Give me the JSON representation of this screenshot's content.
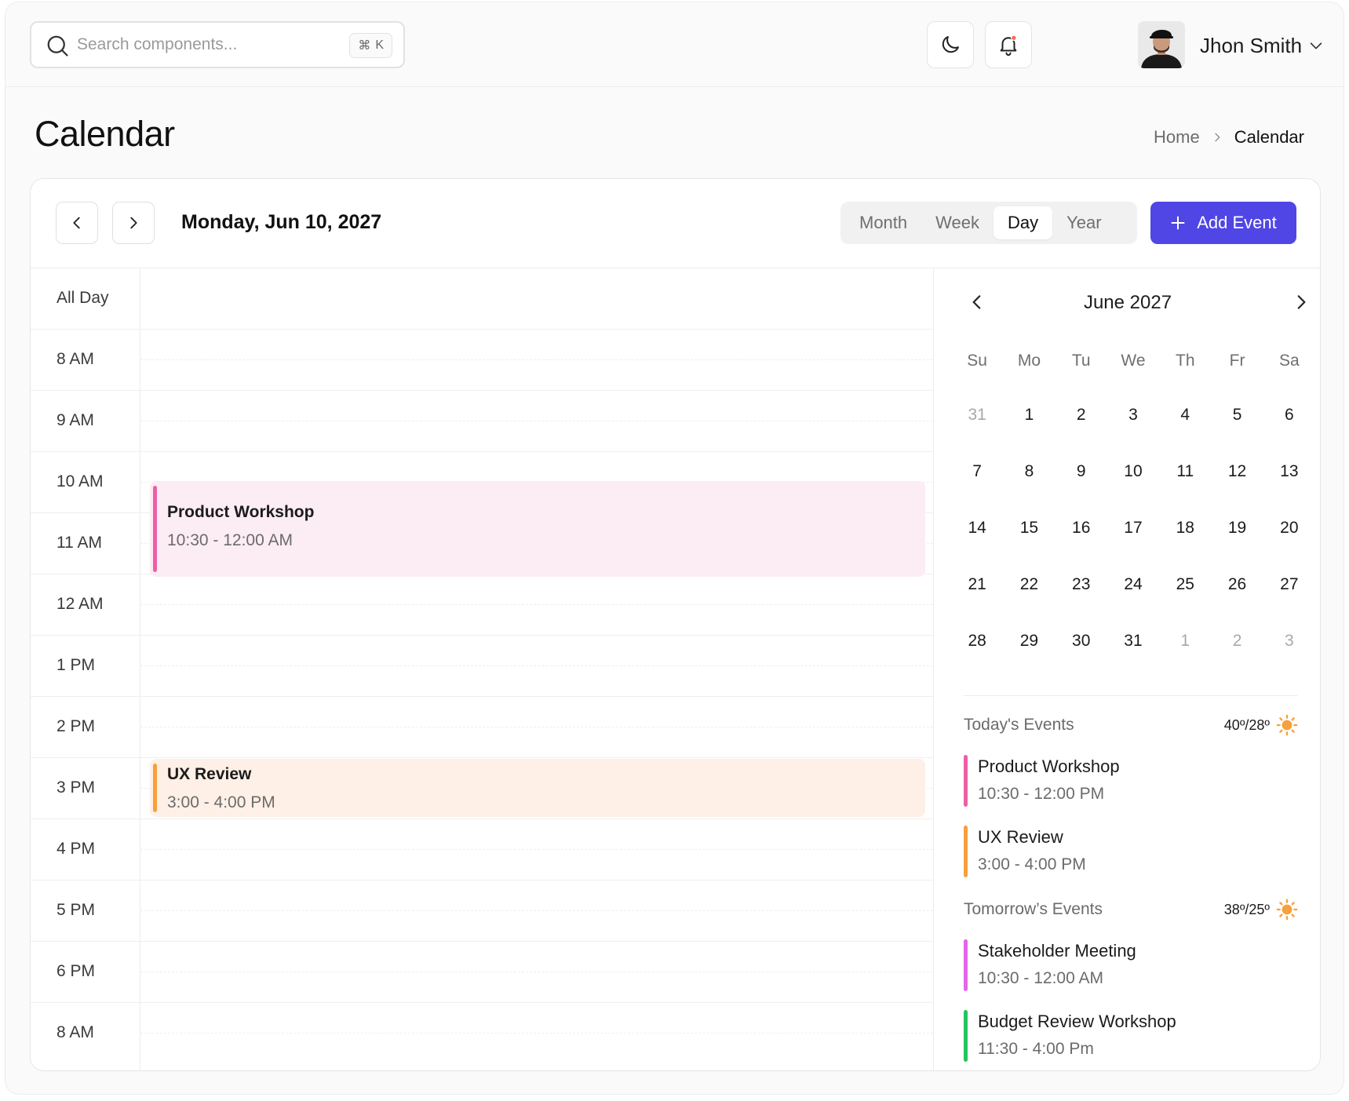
{
  "header": {
    "search_placeholder": "Search components...",
    "search_shortcut_symbol": "⌘",
    "search_shortcut_key": "K",
    "user_name": "Jhon Smith",
    "notification_dot_color": "#f26b5b"
  },
  "page": {
    "title": "Calendar",
    "breadcrumb": {
      "home": "Home",
      "current": "Calendar"
    }
  },
  "toolbar": {
    "current_date": "Monday, Jun 10, 2027",
    "views": [
      "Month",
      "Week",
      "Day",
      "Year"
    ],
    "active_view": "Day",
    "add_event_label": "Add Event",
    "accent_color": "#4f46e5"
  },
  "day_grid": {
    "all_day_label": "All Day",
    "hours": [
      "8 AM",
      "9 AM",
      "10 AM",
      "11 AM",
      "12 AM",
      "1 PM",
      "2 PM",
      "3 PM",
      "4 PM",
      "5 PM",
      "6 PM",
      "8 AM"
    ],
    "events": [
      {
        "title": "Product Workshop",
        "time": "10:30 - 12:00 AM",
        "color": "#ec5fa5"
      },
      {
        "title": "UX Review",
        "time": "3:00 - 4:00 PM",
        "color": "#f7a03c"
      }
    ]
  },
  "mini_calendar": {
    "title": "June 2027",
    "weekdays": [
      "Su",
      "Mo",
      "Tu",
      "We",
      "Th",
      "Fr",
      "Sa"
    ],
    "weeks": [
      [
        {
          "d": "31",
          "m": true
        },
        {
          "d": "1"
        },
        {
          "d": "2"
        },
        {
          "d": "3"
        },
        {
          "d": "4"
        },
        {
          "d": "5"
        },
        {
          "d": "6"
        }
      ],
      [
        {
          "d": "7"
        },
        {
          "d": "8"
        },
        {
          "d": "9"
        },
        {
          "d": "10"
        },
        {
          "d": "11"
        },
        {
          "d": "12"
        },
        {
          "d": "13"
        }
      ],
      [
        {
          "d": "14"
        },
        {
          "d": "15"
        },
        {
          "d": "16"
        },
        {
          "d": "17"
        },
        {
          "d": "18"
        },
        {
          "d": "19"
        },
        {
          "d": "20"
        }
      ],
      [
        {
          "d": "21"
        },
        {
          "d": "22"
        },
        {
          "d": "23"
        },
        {
          "d": "24"
        },
        {
          "d": "25"
        },
        {
          "d": "26"
        },
        {
          "d": "27"
        }
      ],
      [
        {
          "d": "28"
        },
        {
          "d": "29"
        },
        {
          "d": "30"
        },
        {
          "d": "31"
        },
        {
          "d": "1",
          "m": true
        },
        {
          "d": "2",
          "m": true
        },
        {
          "d": "3",
          "m": true
        }
      ]
    ]
  },
  "today": {
    "label": "Today's Events",
    "temperature": "40º/28º",
    "events": [
      {
        "title": "Product Workshop",
        "time": "10:30 - 12:00 PM",
        "color": "#ec5fa5"
      },
      {
        "title": "UX Review",
        "time": "3:00 - 4:00 PM",
        "color": "#f7a03c"
      }
    ]
  },
  "tomorrow": {
    "label": "Tomorrow’s Events",
    "temperature": "38º/25º",
    "events": [
      {
        "title": "Stakeholder Meeting",
        "time": "10:30 - 12:00 AM",
        "color": "#e366e8"
      },
      {
        "title": "Budget Review Workshop",
        "time": "11:30 - 4:00 Pm",
        "color": "#22c55e"
      }
    ]
  }
}
